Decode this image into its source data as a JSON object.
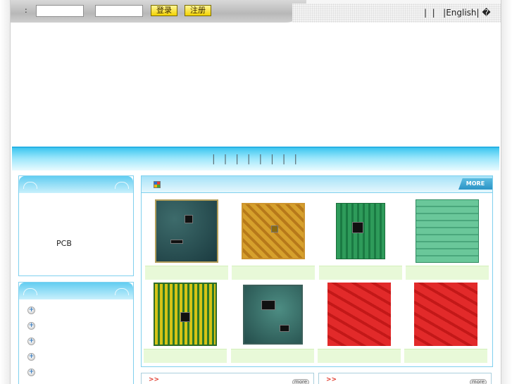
{
  "login": {
    "colon": ":",
    "login_button": "登录",
    "register_button": "注册"
  },
  "toplinks": "|  |   |English| �",
  "nav": {
    "separators": "|  |  |  |  |  |  |  |"
  },
  "sidebar": {
    "pcb_label": "PCB",
    "categories": [
      "",
      "",
      "",
      "",
      "",
      ""
    ]
  },
  "products": {
    "more_label": "MORE"
  },
  "bottom": {
    "more_label": "more"
  }
}
